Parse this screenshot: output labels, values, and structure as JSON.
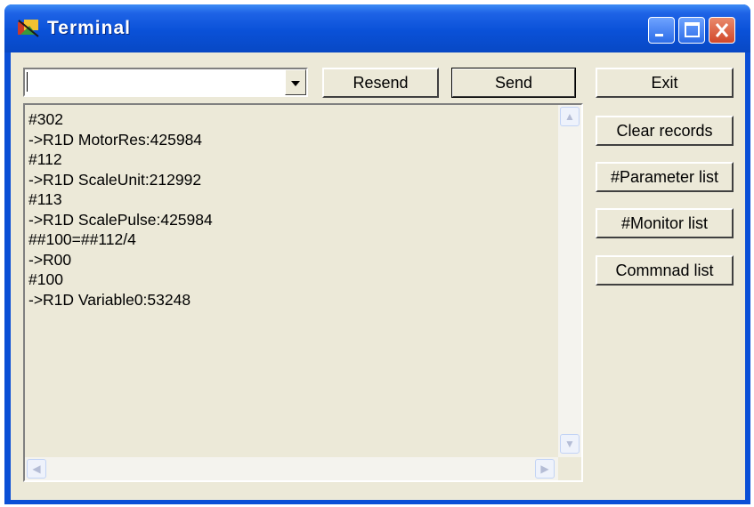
{
  "window": {
    "title": "Terminal"
  },
  "command_input": {
    "value": ""
  },
  "buttons": {
    "resend": "Resend",
    "send": "Send",
    "exit": "Exit",
    "clear_records": "Clear records",
    "parameter_list": "#Parameter list",
    "monitor_list": "#Monitor list",
    "command_list": "Commnad list"
  },
  "log": {
    "lines": [
      "#302",
      "->R1D MotorRes:425984",
      "#112",
      "->R1D ScaleUnit:212992",
      "#113",
      "->R1D ScalePulse:425984",
      "##100=##112/4",
      "->R00",
      "#100",
      "->R1D Variable0:53248"
    ]
  },
  "icons": {
    "app": "app-icon",
    "minimize": "minimize-icon",
    "maximize": "maximize-icon",
    "close": "close-icon",
    "dropdown": "chevron-down-icon",
    "scroll_up": "scroll-up-icon",
    "scroll_down": "scroll-down-icon",
    "scroll_left": "scroll-left-icon",
    "scroll_right": "scroll-right-icon"
  },
  "colors": {
    "titlebar": "#0a51d8",
    "face": "#ece9d8",
    "close_button": "#d2482a"
  }
}
